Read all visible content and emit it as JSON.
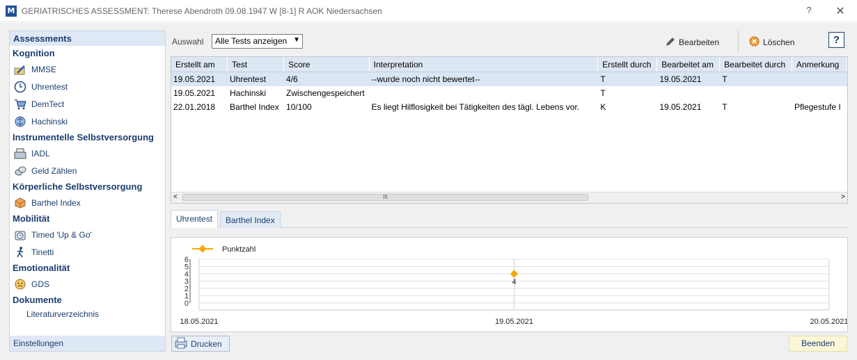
{
  "window": {
    "logo": "M",
    "title": "GERIATRISCHES ASSESSMENT: Therese Abendroth 09.08.1947 W [8-1]  R  AOK Niedersachsen",
    "help": "?",
    "close": "✕"
  },
  "sidebar": {
    "header": "Assessments",
    "groups": [
      {
        "label": "Kognition",
        "items": [
          {
            "label": "MMSE",
            "icon": "pencil-paper-icon"
          },
          {
            "label": "Uhrentest",
            "icon": "clock-icon"
          },
          {
            "label": "DemTect",
            "icon": "cart-icon"
          },
          {
            "label": "Hachinski",
            "icon": "brain-icon"
          }
        ]
      },
      {
        "label": "Instrumentelle Selbstversorgung",
        "items": [
          {
            "label": "IADL",
            "icon": "cash-register-icon"
          },
          {
            "label": "Geld Zählen",
            "icon": "coins-icon"
          }
        ]
      },
      {
        "label": "Körperliche Selbstversorgung",
        "items": [
          {
            "label": "Barthel Index",
            "icon": "box-icon"
          }
        ]
      },
      {
        "label": "Mobilität",
        "items": [
          {
            "label": "Timed 'Up & Go'",
            "icon": "stopwatch-walk-icon"
          },
          {
            "label": "Tinetti",
            "icon": "walking-person-icon"
          }
        ]
      },
      {
        "label": "Emotionalität",
        "items": [
          {
            "label": "GDS",
            "icon": "face-icon"
          }
        ]
      },
      {
        "label": "Dokumente",
        "items": [
          {
            "label": "Literaturverzeichnis",
            "icon": ""
          }
        ]
      }
    ],
    "footer": "Einstellungen"
  },
  "toolbar": {
    "filter_label": "Auswahl",
    "filter_value": "Alle Tests anzeigen",
    "edit_label": "Bearbeiten",
    "delete_label": "Löschen",
    "help_label": "?"
  },
  "grid": {
    "columns": [
      "Erstellt am",
      "Test",
      "Score",
      "Interpretation",
      "Erstellt durch",
      "Bearbeitet am",
      "Bearbeitet durch",
      "Anmerkung"
    ],
    "rows": [
      [
        "19.05.2021",
        "Uhrentest",
        "4/6",
        "--wurde noch nicht bewertet--",
        "T",
        "19.05.2021",
        "T",
        ""
      ],
      [
        "19.05.2021",
        "Hachinski",
        "Zwischengespeichert",
        "",
        "T",
        "",
        "",
        ""
      ],
      [
        "22.01.2018",
        "Barthel Index",
        "10/100",
        "Es liegt Hilflosigkeit bei Tätigkeiten des tägl. Lebens vor.",
        "K",
        "19.05.2021",
        "T",
        "Pflegestufe I"
      ]
    ],
    "selected_row": 0,
    "scroll_left": "<",
    "scroll_right": ">",
    "scroll_grip": "III"
  },
  "tabs": [
    {
      "label": "Uhrentest",
      "active": true
    },
    {
      "label": "Barthel Index",
      "active": false
    }
  ],
  "chart_data": {
    "type": "line",
    "series": [
      {
        "name": "Punktzahl",
        "x": [
          "19.05.2021"
        ],
        "values": [
          4
        ],
        "labels": [
          "4"
        ],
        "color": "#f5a800"
      }
    ],
    "x_ticks": [
      "18.05.2021",
      "19.05.2021",
      "20.05.2021"
    ],
    "y_ticks": [
      0,
      1,
      2,
      3,
      4,
      5,
      6
    ],
    "ylim": [
      0,
      6
    ],
    "grid": true,
    "legend": "top-left"
  },
  "footer": {
    "print_label": "Drucken",
    "end_label": "Beenden"
  }
}
